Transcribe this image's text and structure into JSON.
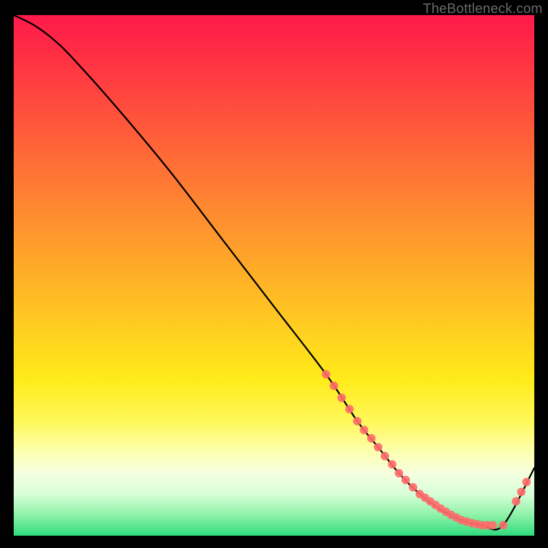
{
  "watermark": "TheBottleneck.com",
  "chart_data": {
    "type": "line",
    "title": "",
    "xlabel": "",
    "ylabel": "",
    "xlim": [
      0,
      100
    ],
    "ylim": [
      0,
      100
    ],
    "grid": false,
    "series": [
      {
        "name": "curve",
        "x": [
          0,
          4,
          8,
          12,
          20,
          30,
          40,
          50,
          60,
          66,
          70,
          74,
          78,
          82,
          86,
          90,
          94,
          100
        ],
        "values": [
          100,
          98,
          95,
          91,
          82,
          70,
          57,
          44,
          31,
          22,
          17,
          12,
          8,
          5,
          3,
          2,
          2,
          13
        ]
      }
    ],
    "markers": [
      {
        "x": 60.0,
        "y": 31.0
      },
      {
        "x": 61.5,
        "y": 28.8
      },
      {
        "x": 63.0,
        "y": 26.5
      },
      {
        "x": 64.5,
        "y": 24.3
      },
      {
        "x": 66.0,
        "y": 22.0
      },
      {
        "x": 67.3,
        "y": 20.3
      },
      {
        "x": 68.7,
        "y": 18.7
      },
      {
        "x": 70.0,
        "y": 17.0
      },
      {
        "x": 71.3,
        "y": 15.3
      },
      {
        "x": 72.7,
        "y": 13.7
      },
      {
        "x": 74.0,
        "y": 12.0
      },
      {
        "x": 75.3,
        "y": 10.7
      },
      {
        "x": 76.7,
        "y": 9.3
      },
      {
        "x": 78.0,
        "y": 8.0
      },
      {
        "x": 79.0,
        "y": 7.3
      },
      {
        "x": 80.0,
        "y": 6.6
      },
      {
        "x": 81.0,
        "y": 5.9
      },
      {
        "x": 82.0,
        "y": 5.2
      },
      {
        "x": 83.0,
        "y": 4.6
      },
      {
        "x": 84.0,
        "y": 4.0
      },
      {
        "x": 85.0,
        "y": 3.5
      },
      {
        "x": 86.0,
        "y": 3.0
      },
      {
        "x": 87.0,
        "y": 2.7
      },
      {
        "x": 88.0,
        "y": 2.4
      },
      {
        "x": 89.0,
        "y": 2.2
      },
      {
        "x": 90.0,
        "y": 2.0
      },
      {
        "x": 91.0,
        "y": 2.0
      },
      {
        "x": 92.0,
        "y": 2.0
      },
      {
        "x": 94.0,
        "y": 2.0
      },
      {
        "x": 96.5,
        "y": 6.6
      },
      {
        "x": 97.5,
        "y": 8.4
      },
      {
        "x": 98.5,
        "y": 10.3
      }
    ],
    "colors": {
      "line": "#000000",
      "marker": "#ff6a6a",
      "gradient_top": "#ff1a4b",
      "gradient_bottom": "#2fdc7f"
    }
  }
}
